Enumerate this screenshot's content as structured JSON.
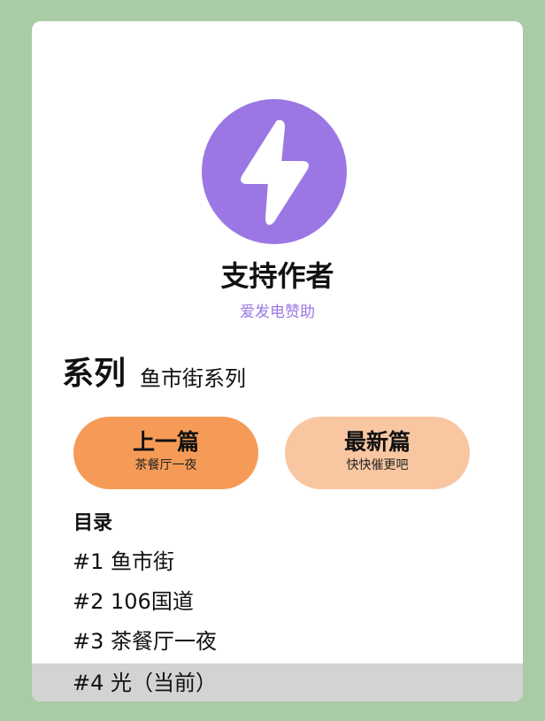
{
  "support": {
    "icon": "lightning-bolt-icon",
    "title": "支持作者",
    "subtitle": "爱发电赞助"
  },
  "series": {
    "heading": "系列",
    "name": "鱼市街系列"
  },
  "nav": {
    "prev": {
      "label": "上一篇",
      "sub": "茶餐厅一夜"
    },
    "latest": {
      "label": "最新篇",
      "sub": "快快催更吧"
    }
  },
  "toc": {
    "heading": "目录",
    "items": [
      {
        "label": "#1 鱼市街"
      },
      {
        "label": "#2 106国道"
      },
      {
        "label": "#3 茶餐厅一夜"
      },
      {
        "label": "#4 光（当前）"
      }
    ]
  },
  "colors": {
    "background": "#a9cba6",
    "accent_purple": "#9b77e4",
    "prev_button": "#f69b57",
    "latest_button": "#f8c7a2",
    "current_highlight": "#d3d3d3"
  }
}
